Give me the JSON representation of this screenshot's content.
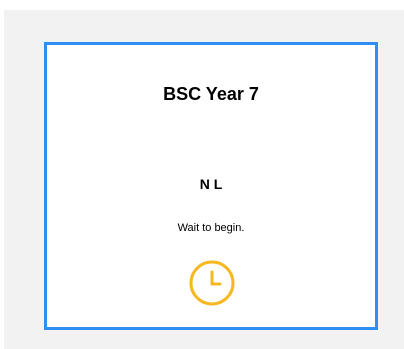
{
  "card": {
    "title": "BSC Year 7",
    "initials": "N L",
    "status": "Wait to begin."
  },
  "icons": {
    "status_icon": "clock-icon"
  },
  "colors": {
    "card_border": "#2f8ef4",
    "clock": "#f5b820",
    "backdrop": "#f2f2f2"
  }
}
